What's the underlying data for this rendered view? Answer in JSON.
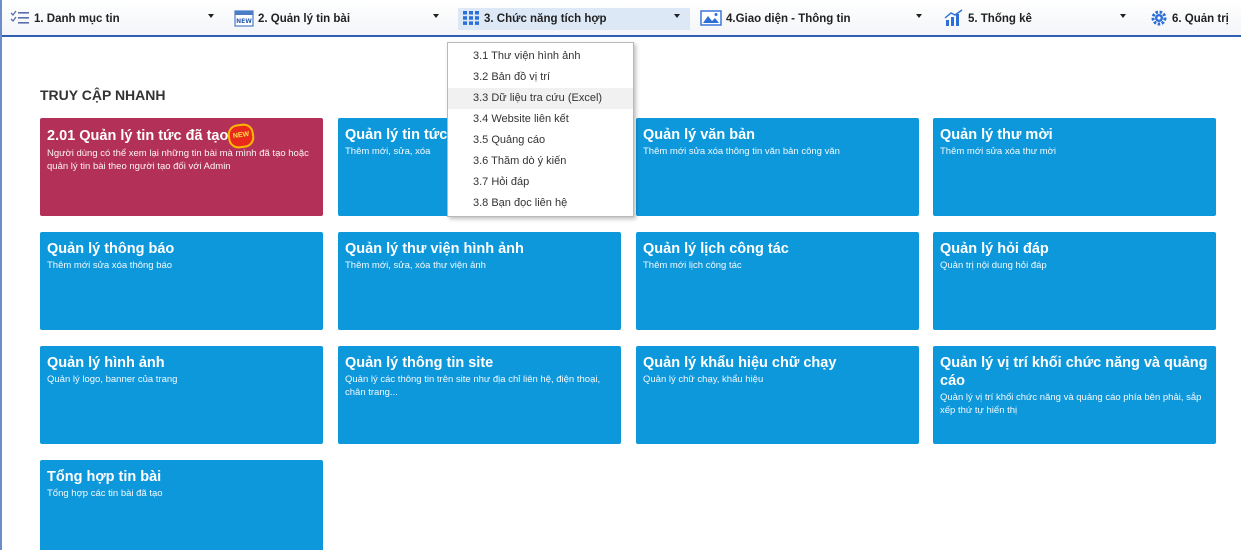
{
  "menu": {
    "items": [
      {
        "label": "1. Danh mục tin",
        "icon": "list-icon"
      },
      {
        "label": "2. Quản lý tin bài",
        "icon": "new-calendar-icon"
      },
      {
        "label": "3. Chức năng tích hợp",
        "icon": "grid-icon"
      },
      {
        "label": "4.Giao diện - Thông tin",
        "icon": "picture-icon"
      },
      {
        "label": "5. Thống kê",
        "icon": "bar-chart-icon"
      },
      {
        "label": "6. Quản trị",
        "icon": "gear-icon"
      }
    ],
    "new_icon_text": "NEW"
  },
  "dropdown": {
    "items": [
      "3.1 Thư viện hình ảnh",
      "3.2 Bản đồ vị trí",
      "3.3 Dữ liệu tra cứu (Excel)",
      "3.4 Website liên kết",
      "3.5 Quảng cáo",
      "3.6 Thăm dò ý kiến",
      "3.7 Hỏi đáp",
      "3.8 Bạn đọc liên hệ"
    ]
  },
  "section_title": "TRUY CẬP NHANH",
  "tiles": [
    {
      "title": "2.01 Quản lý tin tức đã tạo",
      "badge": "NEW",
      "desc": "Người dùng có thể xem lại những tin bài mà mình đã tạo hoặc quản lý tin bài theo người tạo đối với Admin"
    },
    {
      "title": "Quản lý tin tức",
      "desc": "Thêm mới, sửa, xóa"
    },
    {
      "title": "Quản lý văn bản",
      "desc": "Thêm mới sửa xóa thông tin văn bản công văn"
    },
    {
      "title": "Quản lý thư mời",
      "desc": "Thêm mới sửa xóa thư mời"
    },
    {
      "title": "Quản lý thông báo",
      "desc": "Thêm mới sửa xóa thông báo"
    },
    {
      "title": "Quản lý thư viện hình ảnh",
      "desc": "Thêm mới, sửa, xóa thư viện ảnh"
    },
    {
      "title": "Quản lý lịch công tác",
      "desc": "Thêm mới lịch công tác"
    },
    {
      "title": "Quản lý hỏi đáp",
      "desc": "Quản trị nội dung hỏi đáp"
    },
    {
      "title": "Quản lý hình ảnh",
      "desc": "Quản lý logo, banner của trang"
    },
    {
      "title": "Quản lý thông tin site",
      "desc": "Quản lý các thông tin trên site như địa chỉ liên hệ, điện thoại, chân trang..."
    },
    {
      "title": "Quản lý khẩu hiệu chữ chạy",
      "desc": "Quản lý chữ chạy, khẩu hiệu"
    },
    {
      "title": "Quản lý vị trí khối chức năng và quảng cáo",
      "desc": "Quản lý vị trí khối chức năng và quảng cáo phía bên phải, sắp xếp thứ tự hiển thị"
    },
    {
      "title": "Tổng hợp tin bài",
      "desc": "Tổng hợp các tin bài đã tạo"
    }
  ],
  "colors": {
    "tile_blue": "#0e98dc",
    "tile_red": "#b33159",
    "menu_border": "#2f5fb3"
  }
}
